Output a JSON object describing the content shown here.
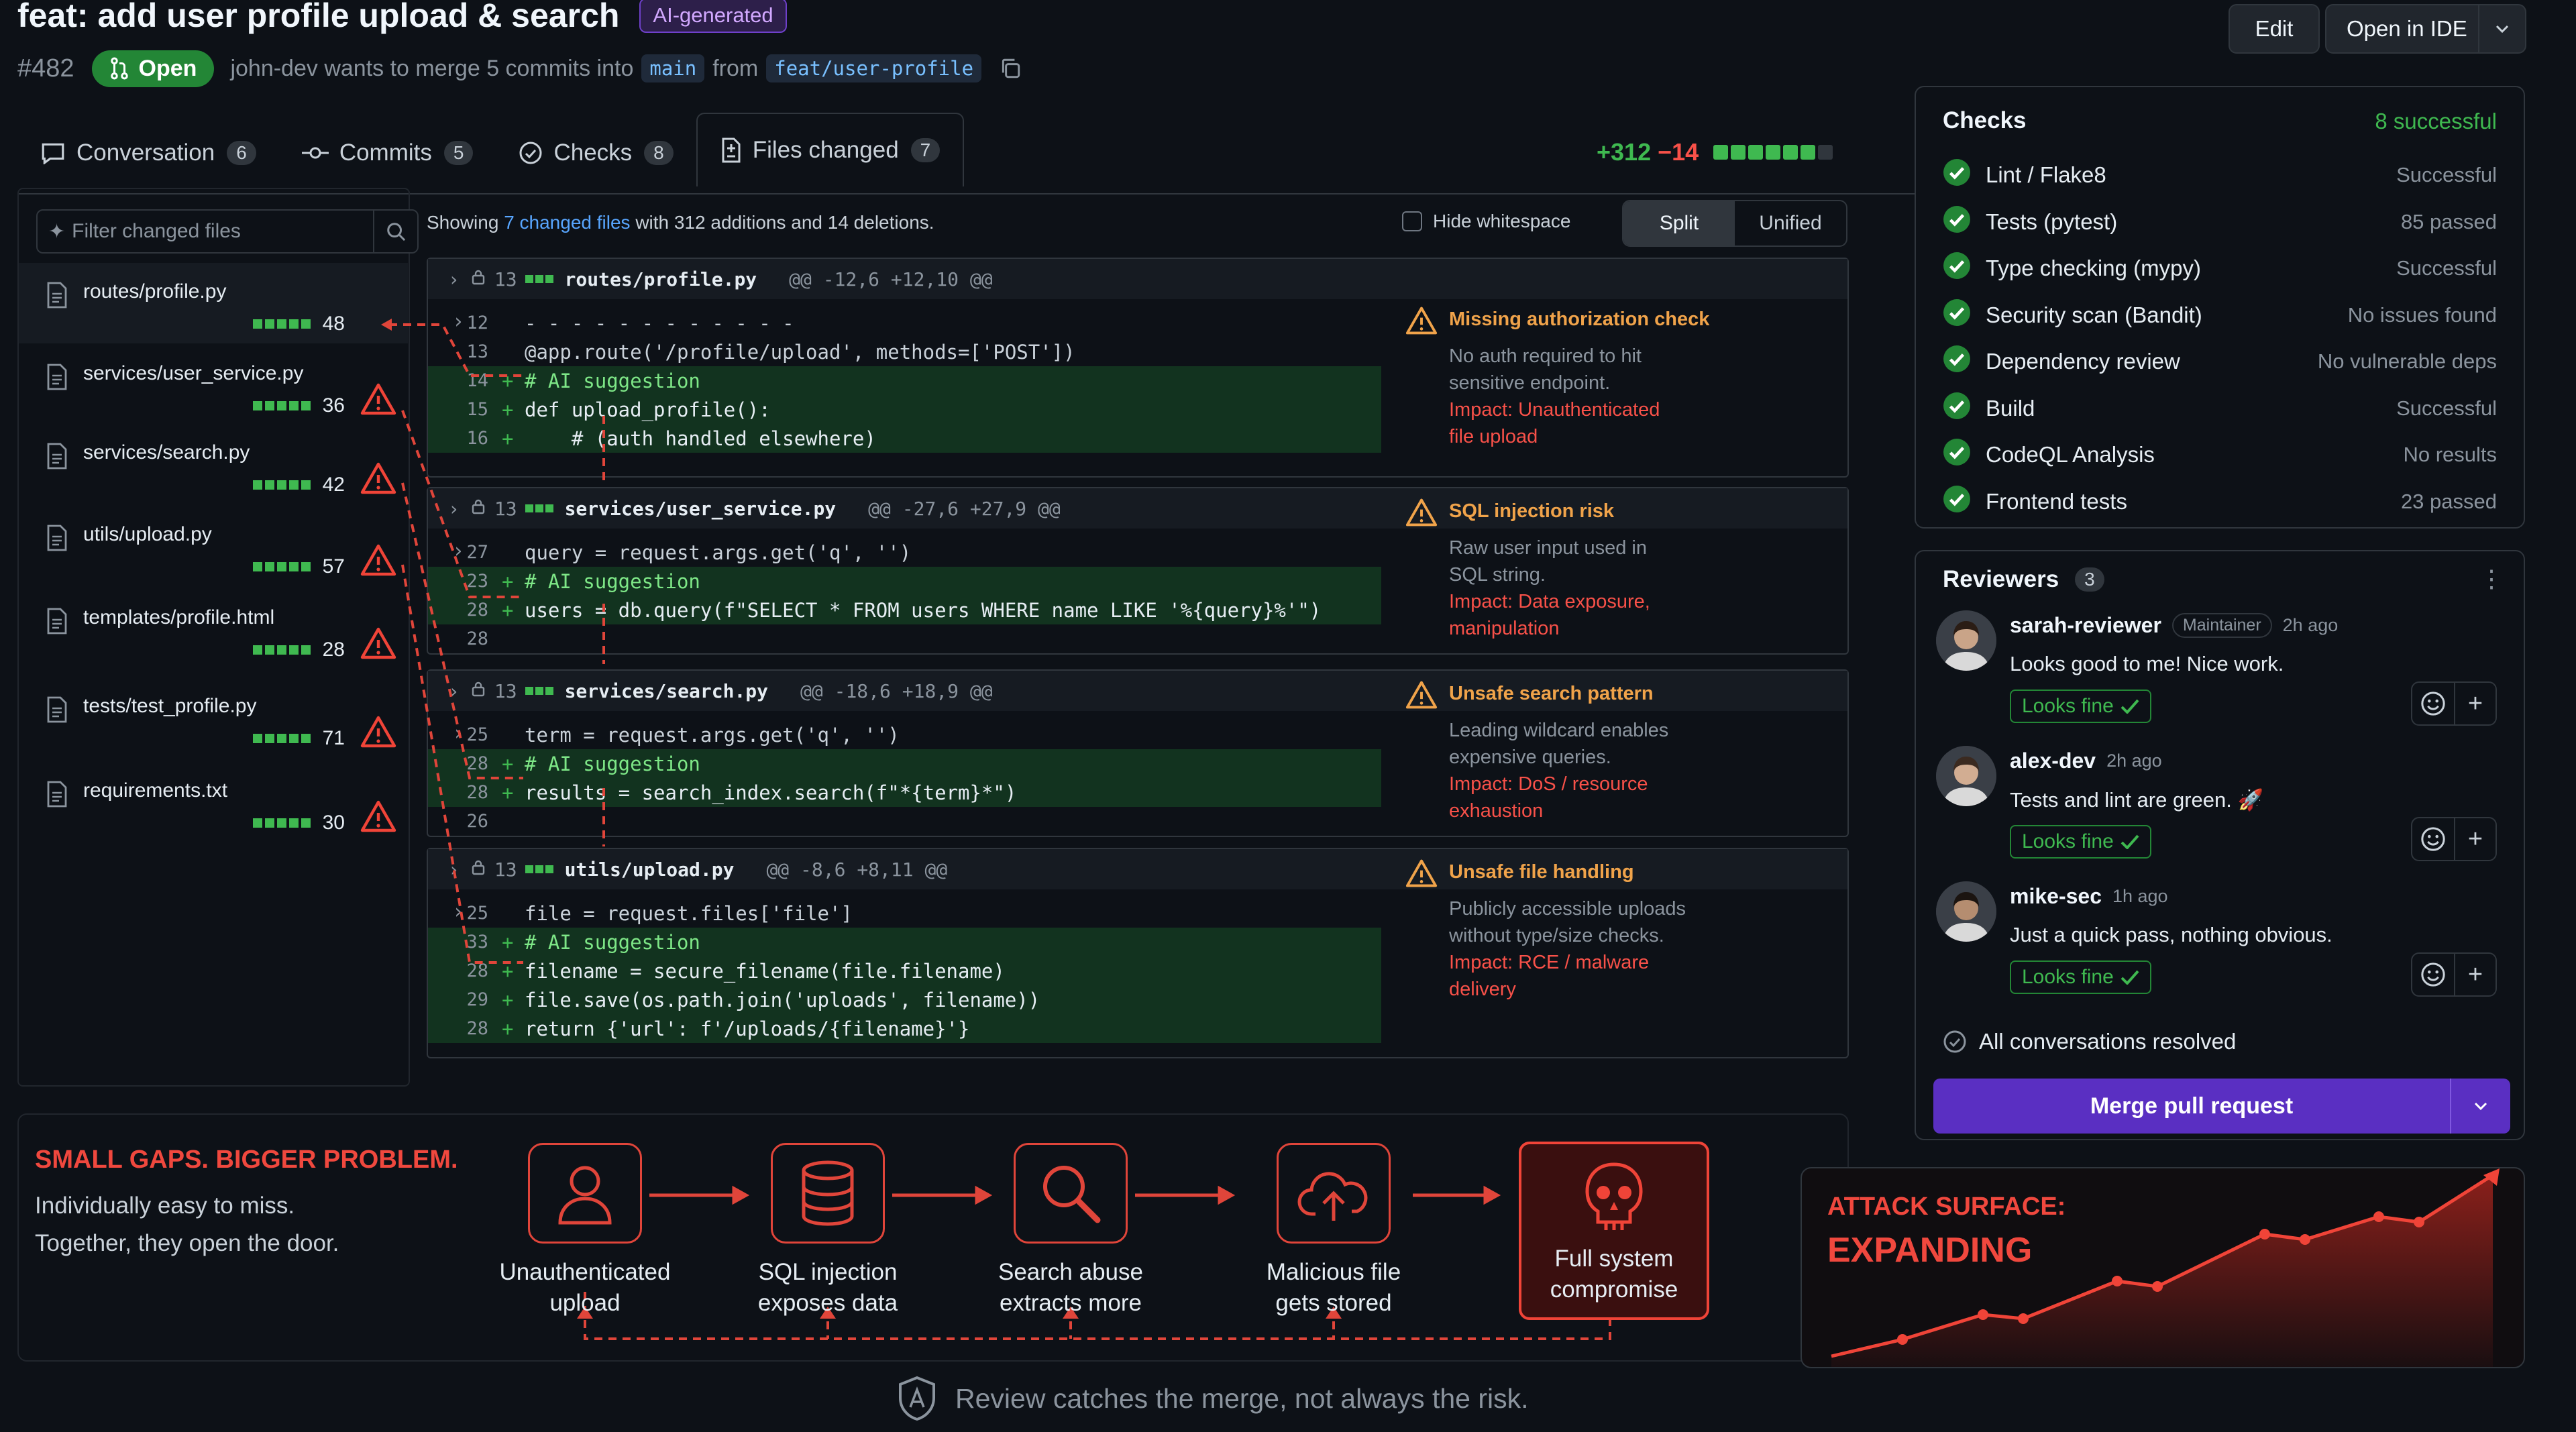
{
  "pr": {
    "title": "feat: add user profile upload & search",
    "ai_badge": "AI-generated",
    "number": "#482",
    "state": "Open",
    "summary": "john-dev wants to merge 5 commits into",
    "base_branch": "main",
    "from_word": "from",
    "head_branch": "feat/user-profile"
  },
  "header_buttons": {
    "edit": "Edit",
    "open_ide": "Open in IDE"
  },
  "tabs": [
    {
      "label": "Conversation",
      "count": "6"
    },
    {
      "label": "Commits",
      "count": "5"
    },
    {
      "label": "Checks",
      "count": "8"
    },
    {
      "label": "Files changed",
      "count": "7"
    }
  ],
  "diffstat": {
    "additions": "+312",
    "deletions": "−14"
  },
  "file_filter": {
    "placeholder": "Filter changed files"
  },
  "files": [
    {
      "name": "routes/profile.py",
      "count": "48"
    },
    {
      "name": "services/user_service.py",
      "count": "36"
    },
    {
      "name": "services/search.py",
      "count": "42"
    },
    {
      "name": "utils/upload.py",
      "count": "57"
    },
    {
      "name": "templates/profile.html",
      "count": "28"
    },
    {
      "name": "tests/test_profile.py",
      "count": "71"
    },
    {
      "name": "requirements.txt",
      "count": "30"
    }
  ],
  "showing": {
    "pre": "Showing",
    "link": "7 changed files",
    "post": "with 312 additions and 14 deletions."
  },
  "hide_whitespace": "Hide whitespace",
  "view_toggle": {
    "split": "Split",
    "unified": "Unified"
  },
  "diffs": [
    {
      "lines_num": "13",
      "path": "routes/profile.py",
      "hunk": "@@ -12,6 +12,10 @@",
      "l1n": "12",
      "l2n": "13",
      "l2": "@app.route('/profile/upload', methods=['POST'])",
      "a1n": "14",
      "a1": "# AI suggestion",
      "a2n": "15",
      "a2": "def upload_profile():",
      "a3n": "16",
      "a3": "    # (auth handled elsewhere)",
      "annot": {
        "title": "Missing authorization check",
        "body1": "No auth required to hit",
        "body2": "sensitive endpoint.",
        "impact1": "Impact: Unauthenticated",
        "impact2": "file upload"
      }
    },
    {
      "lines_num": "13",
      "path": "services/user_service.py",
      "hunk": "@@ -27,6 +27,9 @@",
      "c1n": "27",
      "c1": "query = request.args.get('q', '')",
      "a1n": "23",
      "a1": "# AI suggestion",
      "a2n": "28",
      "a2": "users = db.query(f\"SELECT * FROM users WHERE name LIKE '%{query}%'\")",
      "c2n": "28",
      "annot": {
        "title": "SQL injection risk",
        "body1": "Raw user input used in",
        "body2": "SQL string.",
        "impact1": "Impact: Data exposure,",
        "impact2": "manipulation"
      }
    },
    {
      "lines_num": "13",
      "path": "services/search.py",
      "hunk": "@@ -18,6 +18,9 @@",
      "c1n": "25",
      "c1": "term = request.args.get('q', '')",
      "a1n": "28",
      "a1": "# AI suggestion",
      "a2n": "28",
      "a2": "results = search_index.search(f\"*{term}*\")",
      "c2n": "26",
      "annot": {
        "title": "Unsafe search pattern",
        "body1": "Leading wildcard enables",
        "body2": "expensive queries.",
        "impact1": "Impact: DoS / resource",
        "impact2": "exhaustion"
      }
    },
    {
      "lines_num": "13",
      "path": "utils/upload.py",
      "hunk": "@@ -8,6 +8,11 @@",
      "c1n": "25",
      "c1": "file = request.files['file']",
      "a1n": "33",
      "a1": "# AI suggestion",
      "a2n": "28",
      "a2": "filename = secure_filename(file.filename)",
      "a3n": "29",
      "a3": "file.save(os.path.join('uploads', filename))",
      "a4n": "28",
      "a4": "return {'url': f'/uploads/{filename}'}",
      "annot": {
        "title": "Unsafe file handling",
        "body1": "Publicly accessible uploads",
        "body2": "without type/size checks.",
        "impact1": "Impact: RCE / malware",
        "impact2": "delivery"
      }
    }
  ],
  "checks": {
    "title": "Checks",
    "summary": "8 successful",
    "items": [
      {
        "name": "Lint / Flake8",
        "status": "Successful"
      },
      {
        "name": "Tests (pytest)",
        "status": "85 passed"
      },
      {
        "name": "Type checking (mypy)",
        "status": "Successful"
      },
      {
        "name": "Security scan (Bandit)",
        "status": "No issues found"
      },
      {
        "name": "Dependency review",
        "status": "No vulnerable deps"
      },
      {
        "name": "Build",
        "status": "Successful"
      },
      {
        "name": "CodeQL Analysis",
        "status": "No results"
      },
      {
        "name": "Frontend tests",
        "status": "23 passed"
      }
    ]
  },
  "reviewers": {
    "title": "Reviewers",
    "count": "3",
    "items": [
      {
        "name": "sarah-reviewer",
        "role": "Maintainer",
        "ago": "2h ago",
        "message": "Looks good to me! Nice work.",
        "verdict": "Looks fine"
      },
      {
        "name": "alex-dev",
        "ago": "2h ago",
        "message": "Tests and lint are green. 🚀",
        "verdict": "Looks fine"
      },
      {
        "name": "mike-sec",
        "ago": "1h ago",
        "message": "Just a quick pass, nothing obvious.",
        "verdict": "Looks fine"
      }
    ],
    "resolved": "All conversations resolved",
    "merge": "Merge pull request"
  },
  "infographic": {
    "title": "SMALL GAPS. BIGGER PROBLEM.",
    "line1": "Individually easy to miss.",
    "line2": "Together, they open the door.",
    "steps": [
      {
        "l1": "Unauthenticated",
        "l2": "upload"
      },
      {
        "l1": "SQL injection",
        "l2": "exposes data"
      },
      {
        "l1": "Search abuse",
        "l2": "extracts more"
      },
      {
        "l1": "Malicious file",
        "l2": "gets stored"
      },
      {
        "l1": "Full system",
        "l2": "compromise"
      }
    ],
    "attack_small": "ATTACK SURFACE:",
    "attack_large": "EXPANDING",
    "footer": "Review catches the merge, not always the risk."
  },
  "colors": {
    "accent_green": "#3fb950",
    "danger": "#f0483e",
    "warning": "#f0a34a",
    "merge_purple": "#5a2fc2"
  }
}
